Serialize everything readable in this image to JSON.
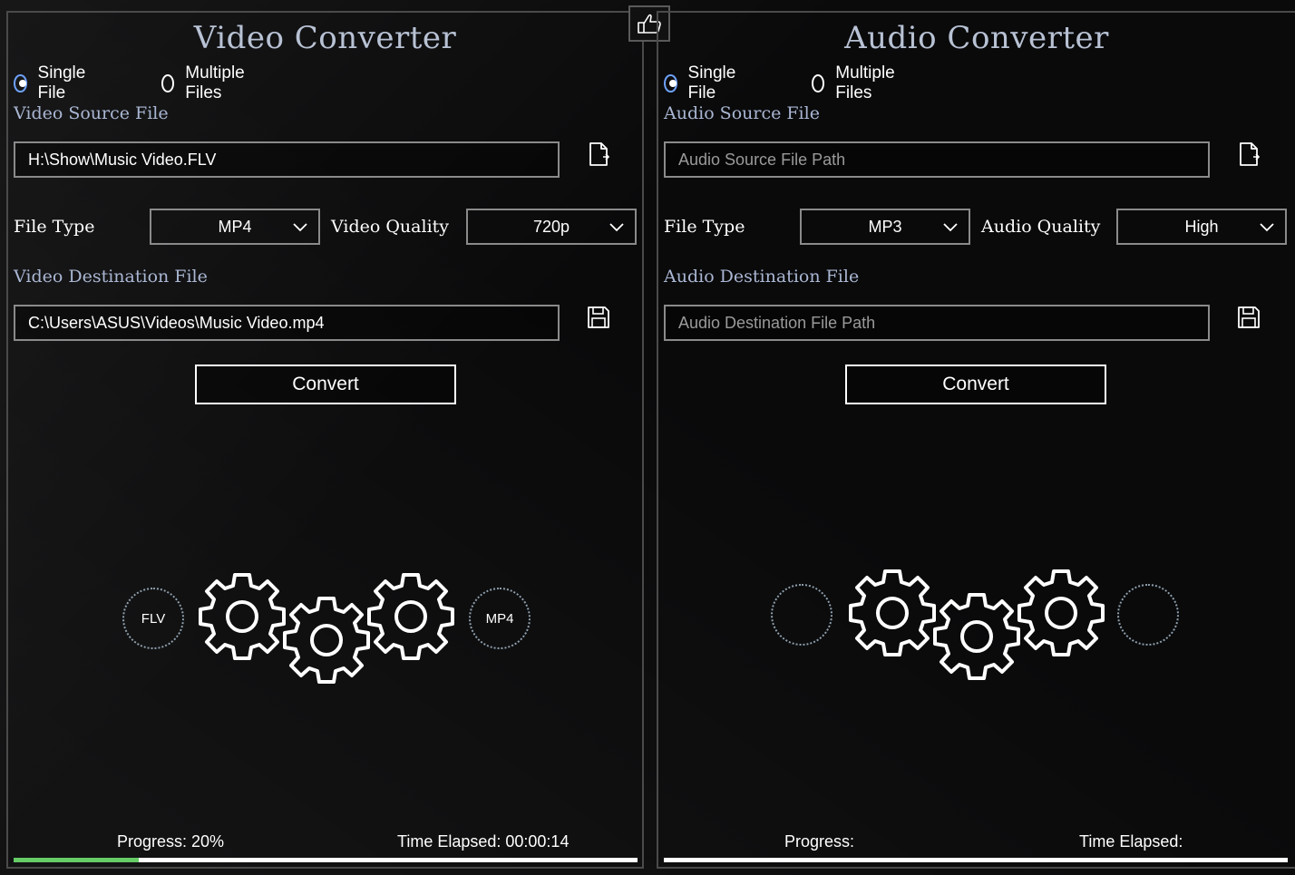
{
  "video": {
    "title": "Video Converter",
    "mode": {
      "single": "Single File",
      "multiple": "Multiple Files",
      "selected": "single"
    },
    "source_label": "Video Source File",
    "source_value": "H:\\Show\\Music Video.FLV",
    "file_type_label": "File Type",
    "file_type_value": "MP4",
    "quality_label": "Video Quality",
    "quality_value": "720p",
    "destination_label": "Video Destination File",
    "destination_value": "C:\\Users\\ASUS\\Videos\\Music Video.mp4",
    "convert_label": "Convert",
    "from_format": "FLV",
    "to_format": "MP4",
    "progress_label": "Progress: 20%",
    "progress_fraction": 0.2,
    "time_label": "Time Elapsed: 00:00:14"
  },
  "audio": {
    "title": "Audio Converter",
    "mode": {
      "single": "Single File",
      "multiple": "Multiple Files",
      "selected": "single"
    },
    "source_label": "Audio Source File",
    "source_placeholder": "Audio Source File Path",
    "file_type_label": "File Type",
    "file_type_value": "MP3",
    "quality_label": "Audio Quality",
    "quality_value": "High",
    "destination_label": "Audio Destination File",
    "destination_placeholder": "Audio Destination File Path",
    "convert_label": "Convert",
    "from_format": "",
    "to_format": "",
    "progress_label": "Progress:",
    "progress_fraction": 0,
    "time_label": "Time Elapsed:"
  },
  "icons": {
    "like": "thumbs-up-icon",
    "open_file": "open-file-icon",
    "save": "save-disk-icon",
    "dropdown": "chevron-down-icon",
    "gear": "gear-icon"
  },
  "colors": {
    "radio_selected": "#6fa3ff",
    "section_label": "#aab7d3",
    "progress_fill": "#66cc66",
    "progress_track": "#ffffff"
  }
}
